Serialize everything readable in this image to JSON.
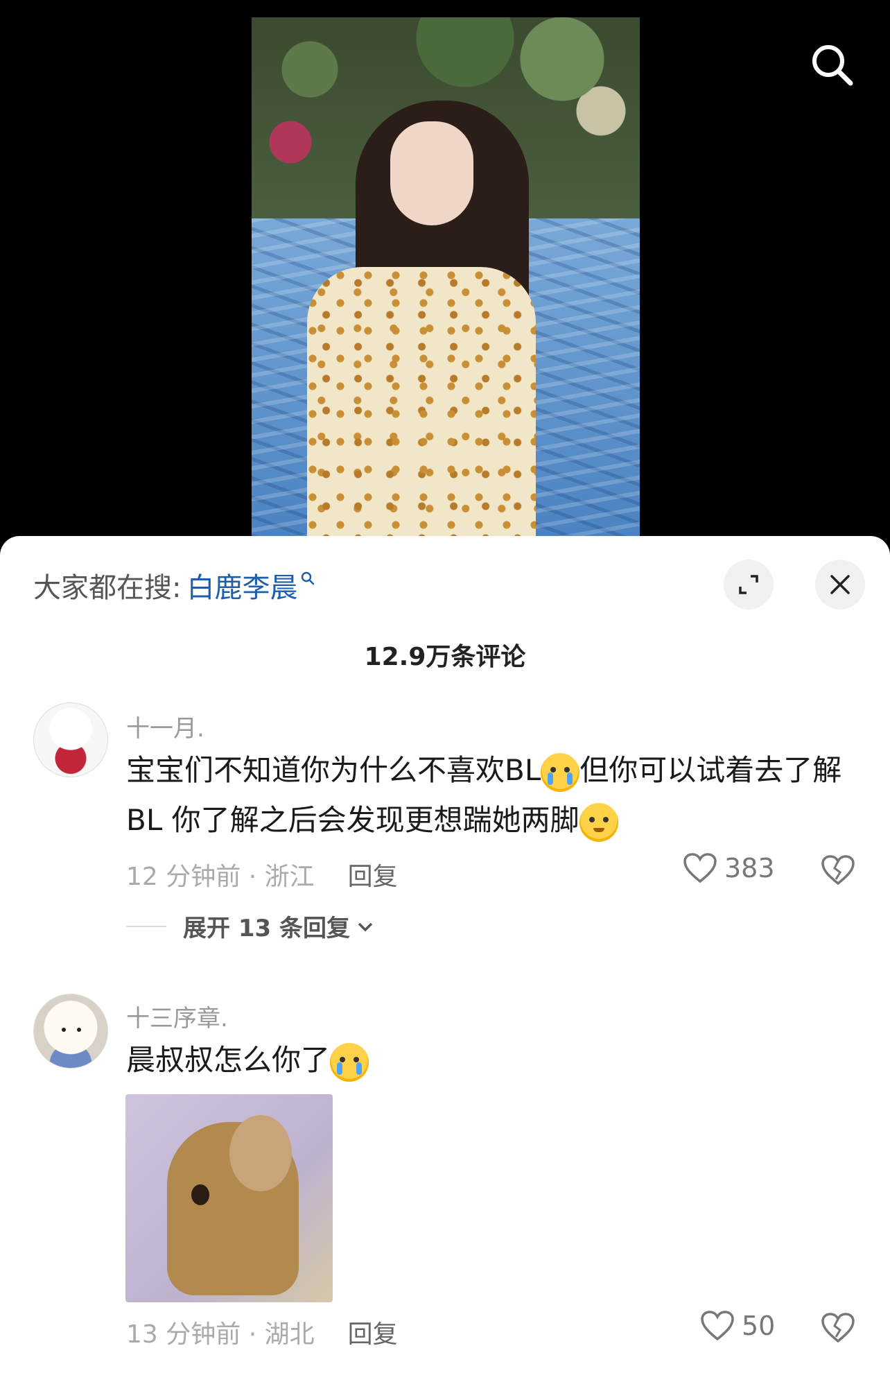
{
  "hot_search": {
    "prefix": "大家都在搜:",
    "term": "白鹿李晨"
  },
  "comments_title": "12.9万条评论",
  "comments": [
    {
      "username": "十一月.",
      "text_part1": "宝宝们不知道你为什么不喜欢BL",
      "text_part2": "但你可以试着去了解BL 你了解之后会发现更想踹她两脚",
      "time_location": "12 分钟前 · 浙江",
      "reply_label": "回复",
      "likes": "383",
      "expand_label": "展开 13 条回复"
    },
    {
      "username": "十三序章.",
      "text_part1": "晨叔叔怎么你了",
      "time_location": "13 分钟前 · 湖北",
      "reply_label": "回复",
      "likes": "50"
    }
  ],
  "icons": {
    "top_search": "search-icon",
    "hot_search_mark": "mini-search-icon",
    "expand": "expand-icon",
    "close": "close-icon",
    "like": "heart-icon",
    "dislike": "broken-heart-icon",
    "chevron": "chevron-down-icon"
  },
  "colors": {
    "link_blue": "#1f5fa9",
    "sheet_bg": "#ffffff",
    "meta_gray": "#aaaaaa"
  }
}
